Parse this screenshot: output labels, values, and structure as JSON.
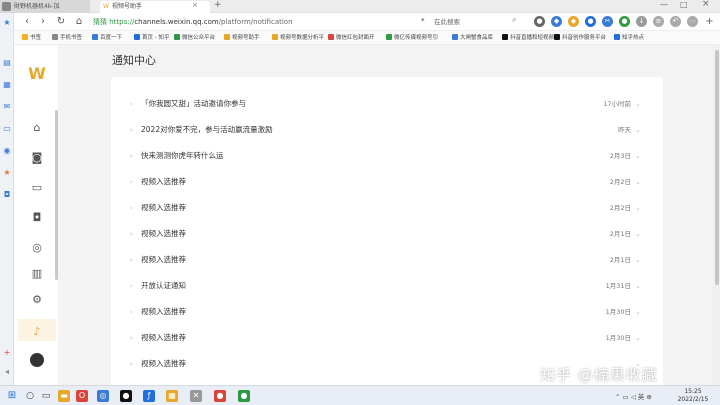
{
  "browser": {
    "window_tab": "財野机器机4k-加",
    "tab_title": "视频号助手",
    "url_label": "猜猜",
    "url_scheme": "https://",
    "url_host": "channels.weixin.qq.com",
    "url_path": "/platform/notification",
    "search_placeholder": "在此搜索",
    "bookmarks": [
      {
        "label": "书签",
        "color": "#f2b01e"
      },
      {
        "label": "手机书签",
        "color": "#888888"
      },
      {
        "label": "百度一下",
        "color": "#3b7bd8"
      },
      {
        "label": "首页 - 知乎",
        "color": "#1e6fd9"
      },
      {
        "label": "微信公众平台",
        "color": "#2e9a45"
      },
      {
        "label": "视频号助手",
        "color": "#e5a82b"
      },
      {
        "label": "视频号数据分析平",
        "color": "#e5a82b"
      },
      {
        "label": "微信红包封面开",
        "color": "#d9453b"
      },
      {
        "label": "微亿传媒视频号引",
        "color": "#2e9a45"
      },
      {
        "label": "大闸蟹食品库",
        "color": "#3b7bd8"
      },
      {
        "label": "抖音直播和短视频",
        "color": "#111111"
      },
      {
        "label": "抖音创作服务平台",
        "color": "#111111"
      },
      {
        "label": "知乎热点",
        "color": "#1e6fd9"
      }
    ]
  },
  "sidebar": {
    "logo_glyph": "W",
    "items": [
      {
        "name": "home-icon",
        "glyph": "⌂"
      },
      {
        "name": "camera-icon",
        "glyph": "◙"
      },
      {
        "name": "message-icon",
        "glyph": "▭"
      },
      {
        "name": "bag-icon",
        "glyph": "◘"
      },
      {
        "name": "target-icon",
        "glyph": "◎"
      },
      {
        "name": "chart-icon",
        "glyph": "▥"
      },
      {
        "name": "gear-icon",
        "glyph": "⚙"
      },
      {
        "name": "bell-icon",
        "glyph": "♪"
      }
    ]
  },
  "page": {
    "title": "通知中心"
  },
  "notifications": [
    {
      "title": "「你我圆又甜」活动邀请你参与",
      "time": "17小时前"
    },
    {
      "title": "2022对你爱不完，参与活动赢流量激励",
      "time": "昨天"
    },
    {
      "title": "快来测测你虎年转什么运",
      "time": "2月3日"
    },
    {
      "title": "视频入选推荐",
      "time": "2月2日"
    },
    {
      "title": "视频入选推荐",
      "time": "2月2日"
    },
    {
      "title": "视频入选推荐",
      "time": "2月1日"
    },
    {
      "title": "视频入选推荐",
      "time": "2月1日"
    },
    {
      "title": "开放认证通知",
      "time": "1月31日"
    },
    {
      "title": "视频入选推荐",
      "time": "1月30日"
    },
    {
      "title": "视频入选推荐",
      "time": "1月30日"
    },
    {
      "title": "视频入选推荐",
      "time": ""
    }
  ],
  "watermark": "知乎 @楠果收藏",
  "taskbar": {
    "time": "15:25",
    "date": "2022/2/15"
  },
  "colors": {
    "accent": "#e5a82b",
    "secure": "#2e9a45",
    "background": "#f3f3f3"
  }
}
